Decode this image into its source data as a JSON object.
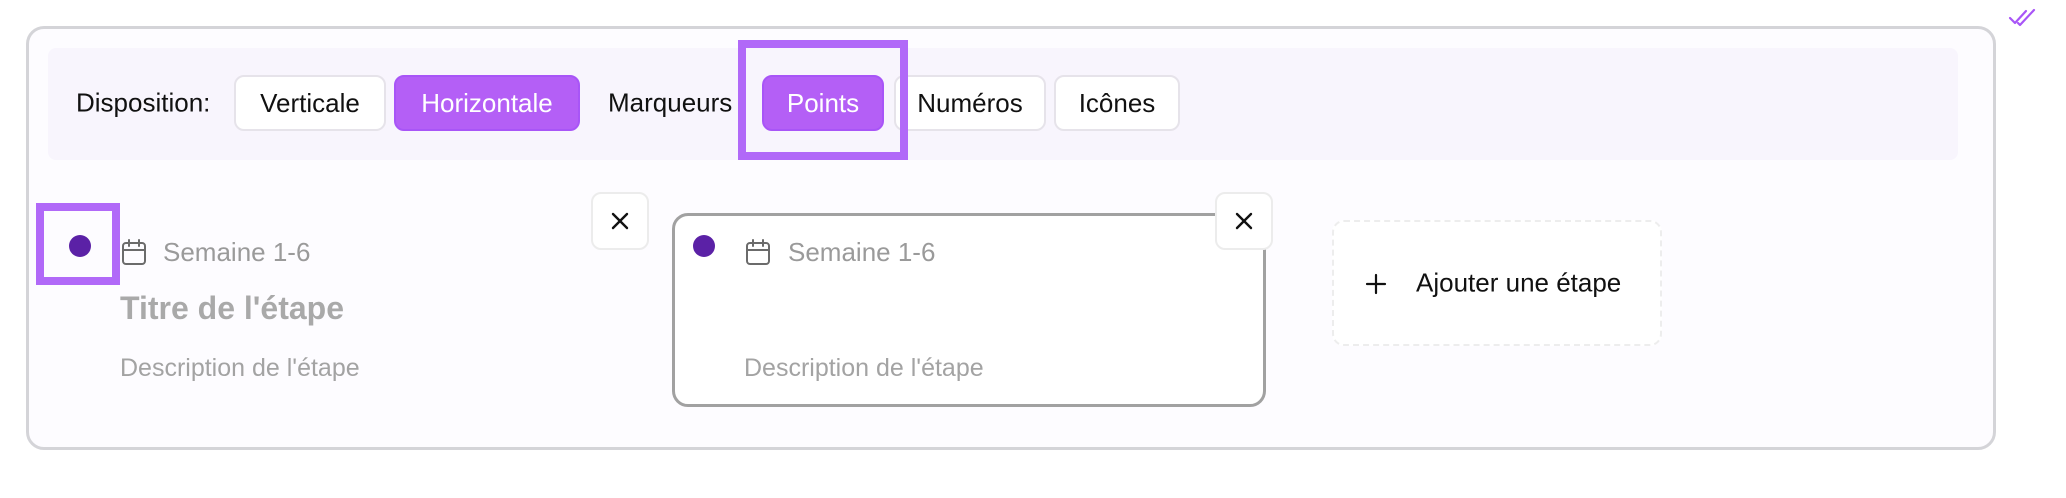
{
  "toolbar": {
    "layout_label": "Disposition:",
    "layout_options": [
      "Verticale",
      "Horizontale"
    ],
    "selected_layout": "Horizontale",
    "markers_label": "Marqueurs",
    "marker_options": [
      "Points",
      "Numéros",
      "Icônes"
    ],
    "selected_marker": "Points"
  },
  "steps": [
    {
      "period": "Semaine 1-6",
      "title_placeholder": "Titre de l'étape",
      "description_placeholder": "Description de l'étape"
    },
    {
      "period": "Semaine 1-6",
      "title_placeholder": "",
      "description_placeholder": "Description de l'étape"
    }
  ],
  "add_step_label": "Ajouter une étape",
  "icons": {
    "calendar": "calendar-icon",
    "close": "close-icon",
    "plus": "plus-icon",
    "check": "double-check-icon",
    "marker": "dot-marker"
  },
  "colors": {
    "accent": "#b45ff6",
    "highlight": "#b169f8",
    "marker": "#5b21a6",
    "placeholder": "#a3a3a3"
  }
}
